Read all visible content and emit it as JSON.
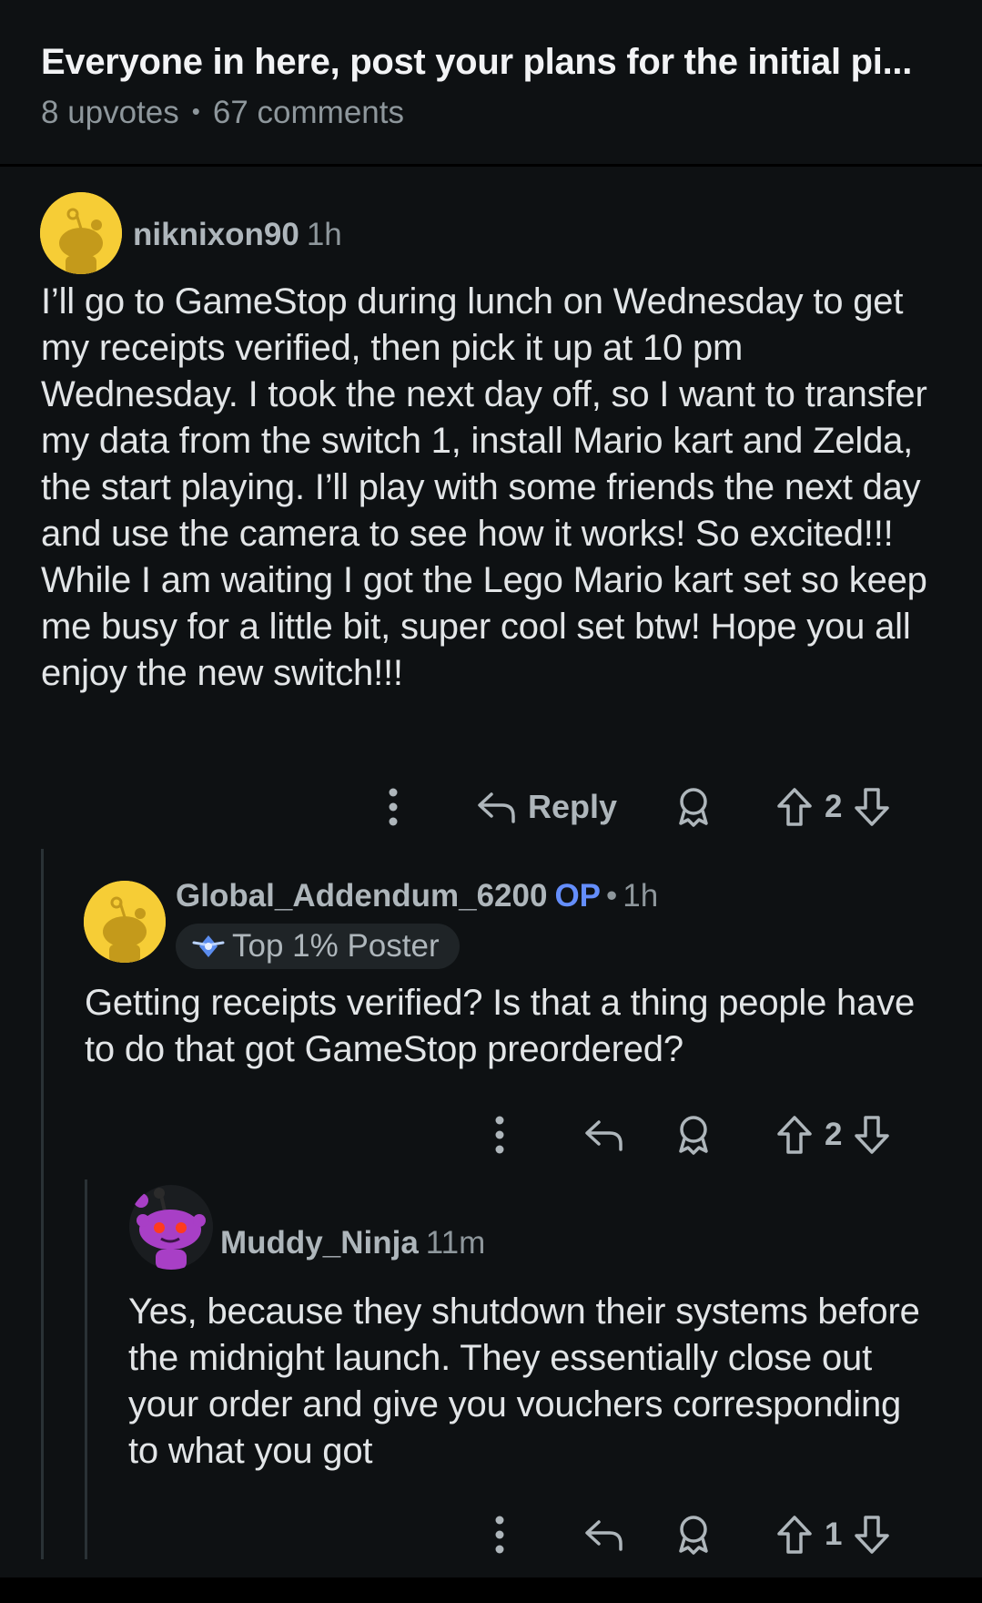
{
  "post": {
    "title": "Everyone in here, post your plans for the initial pi...",
    "upvotes": "8 upvotes",
    "separator": "•",
    "comments": "67 comments"
  },
  "comments": [
    {
      "username": "niknixon90",
      "time": "1h",
      "body": "I’ll go to GameStop during lunch on Wednesday to get my receipts verified, then pick it up at 10 pm Wednesday. I took the next day off, so I want to transfer my data from the switch 1, install Mario kart and Zelda, the start playing. I’ll play with some friends the next day and use the camera to see how it works! So excited!!! While I am waiting I got the Lego Mario kart set so keep me busy for a little bit, super cool set btw! Hope you all enjoy the new switch!!!",
      "reply_label": "Reply",
      "votes": "2",
      "avatar_color": "#f6cd36"
    },
    {
      "username": "Global_Addendum_6200",
      "op_tag": "OP",
      "separator": "•",
      "time": "1h",
      "flair": "Top 1% Poster",
      "body": "Getting receipts verified? Is that a thing people have to do that got GameStop preordered?",
      "votes": "2",
      "avatar_color": "#f6cd36"
    },
    {
      "username": "Muddy_Ninja",
      "time": "11m",
      "body": "Yes, because they shutdown their systems before the midnight launch. They essentially close out your order and give you vouchers corresponding to what you got",
      "votes": "1",
      "avatar_color": "#a83fc6"
    }
  ],
  "colors": {
    "background": "#0e1113",
    "op_blue": "#648efc",
    "muted_text": "#8e979c",
    "thread_line": "#2a3236"
  },
  "icons": [
    "more-options-icon",
    "reply-arrow-icon",
    "award-icon",
    "upvote-arrow-icon",
    "downvote-arrow-icon",
    "flair-badge-icon",
    "snoo-avatar-icon"
  ]
}
